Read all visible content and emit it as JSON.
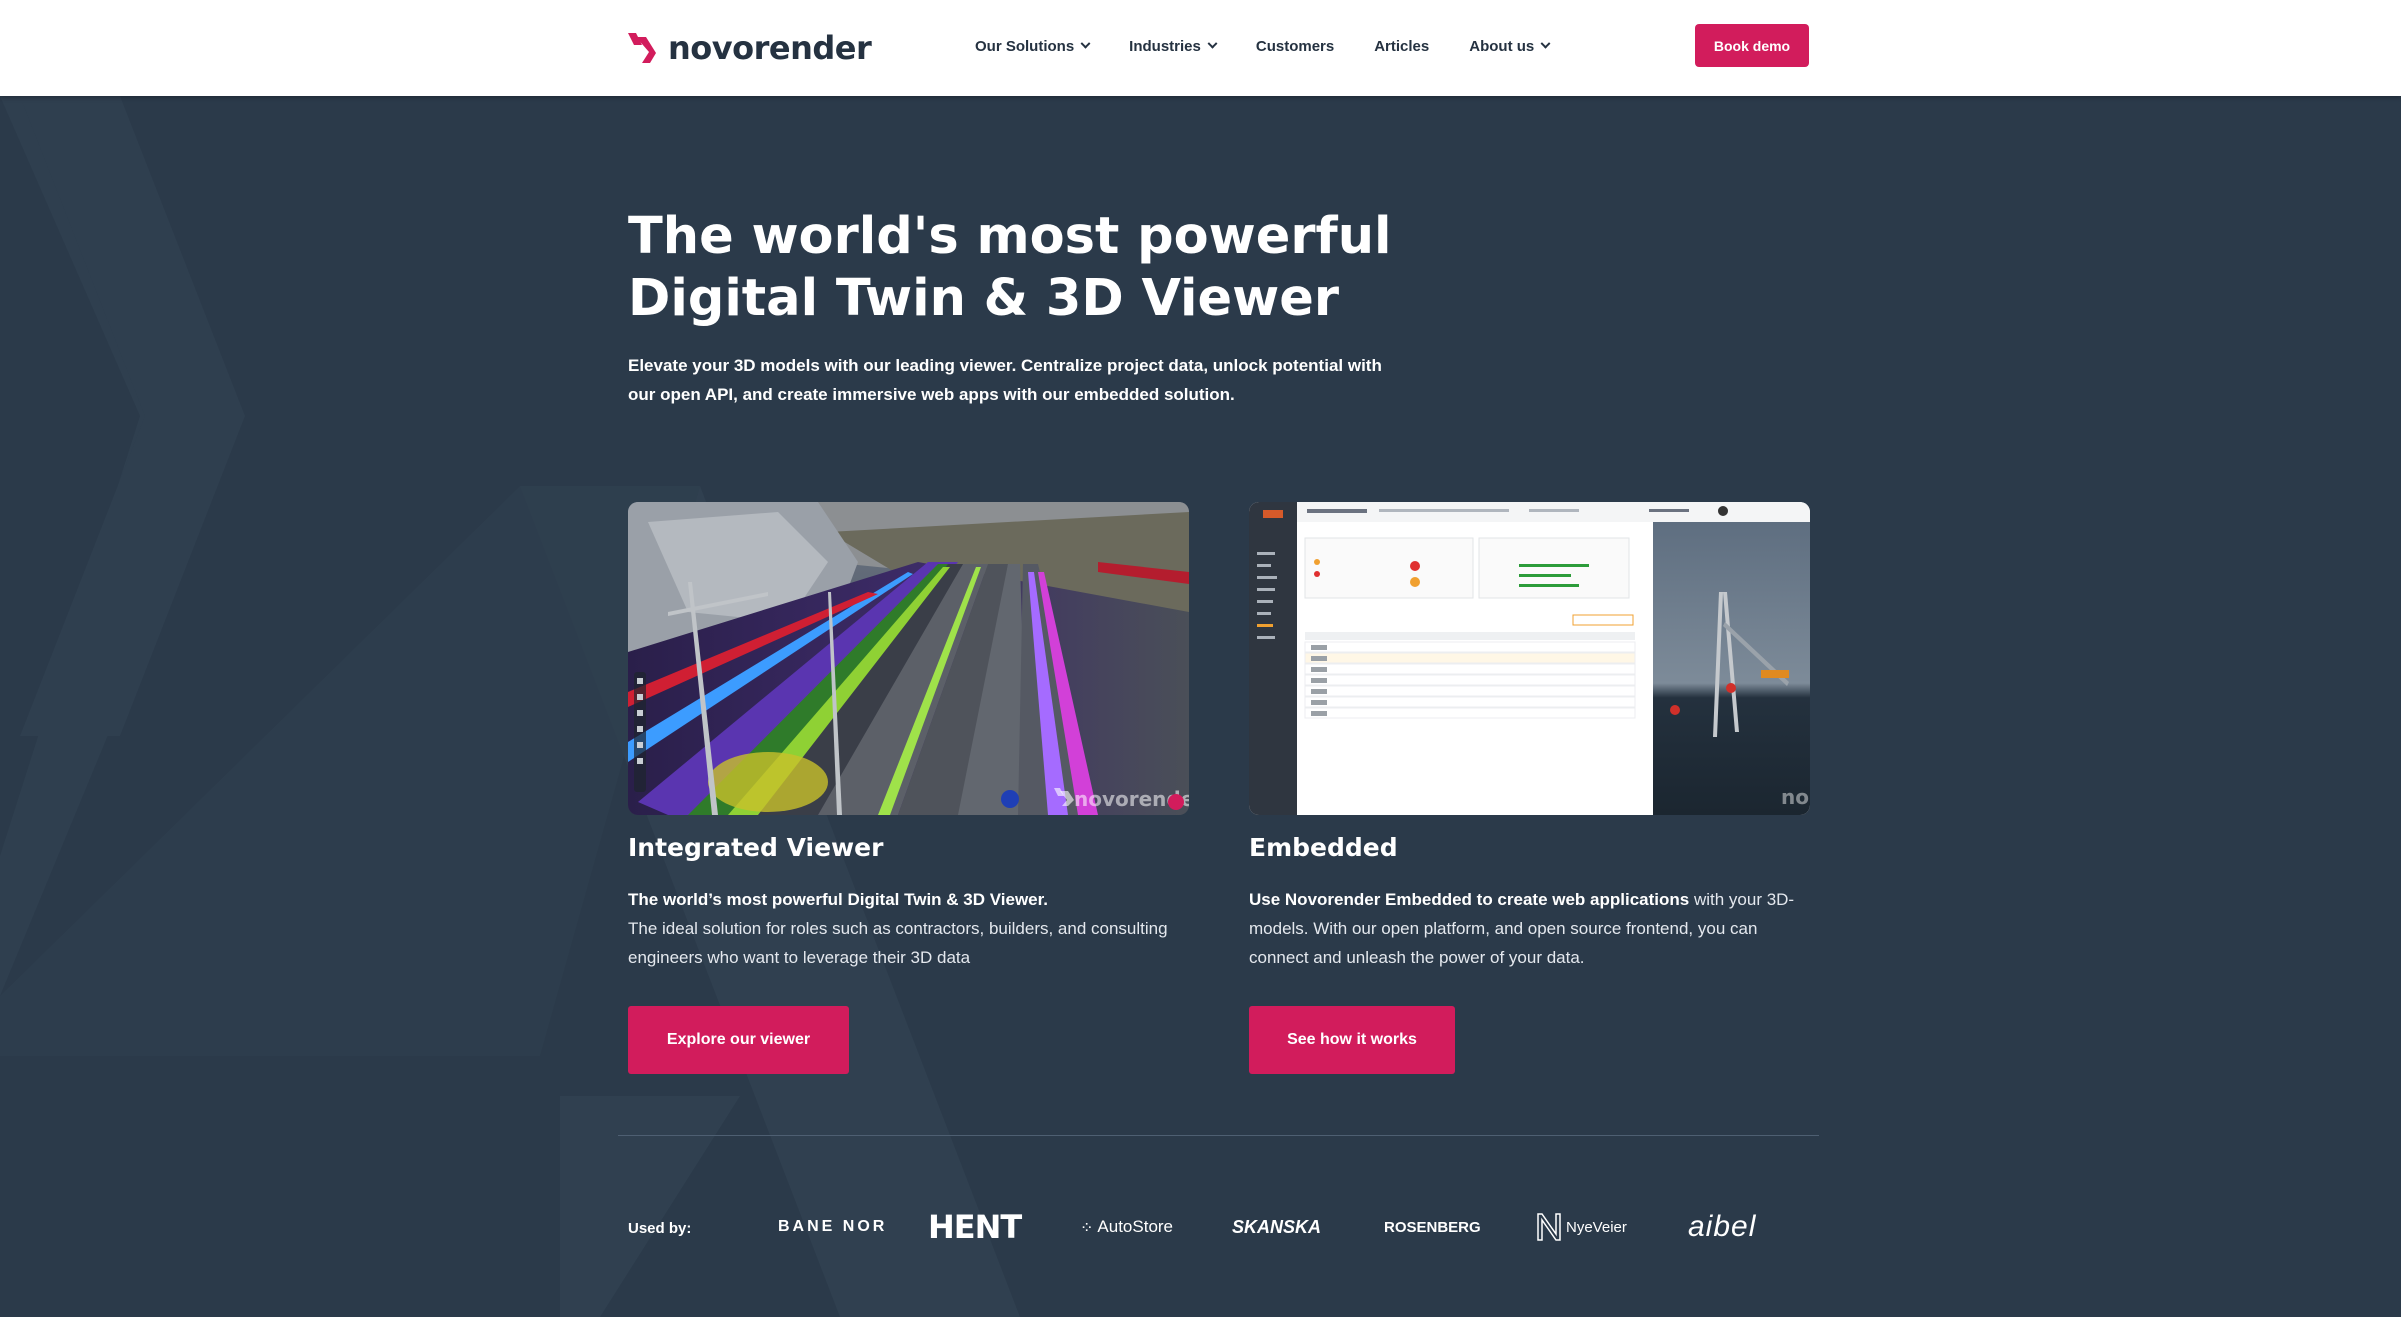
{
  "nav": {
    "brand": "novorender",
    "items": [
      {
        "label": "Our Solutions",
        "dropdown": true
      },
      {
        "label": "Industries",
        "dropdown": true
      },
      {
        "label": "Customers",
        "dropdown": false
      },
      {
        "label": "Articles",
        "dropdown": false
      },
      {
        "label": "About us",
        "dropdown": true
      }
    ],
    "book_demo": "Book demo"
  },
  "hero": {
    "title_line1": "The world's most powerful",
    "title_line2": "Digital Twin & 3D Viewer",
    "subtitle_line1": "Elevate your 3D models with our leading viewer. Centralize project data, unlock potential with",
    "subtitle_line2": "our open API, and create immersive web apps with our embedded solution."
  },
  "cards": {
    "viewer": {
      "title": "Integrated Viewer",
      "lead": "The world’s most powerful Digital Twin & 3D Viewer.",
      "body": "The ideal solution for roles such as contractors, builders, and consulting engineers who want to leverage their 3D data",
      "cta": "Explore our viewer",
      "watermark": "novorender"
    },
    "embedded": {
      "title": "Embedded",
      "lead": "Use Novorender Embedded to create web applications",
      "body": " with your 3D-models. With our open platform, and open source frontend, you can connect and unleash the power of your data.",
      "cta": "See how it works",
      "watermark": "no"
    }
  },
  "used_by": {
    "label": "Used by:",
    "clients": [
      "BANE NOR",
      "HENT",
      "AutoStore",
      "SKANSKA",
      "ROSENBERG",
      "NyeVeier",
      "aibel"
    ]
  },
  "colors": {
    "accent": "#d21c5c",
    "background": "#2b3a4a",
    "nav_text": "#253241"
  }
}
